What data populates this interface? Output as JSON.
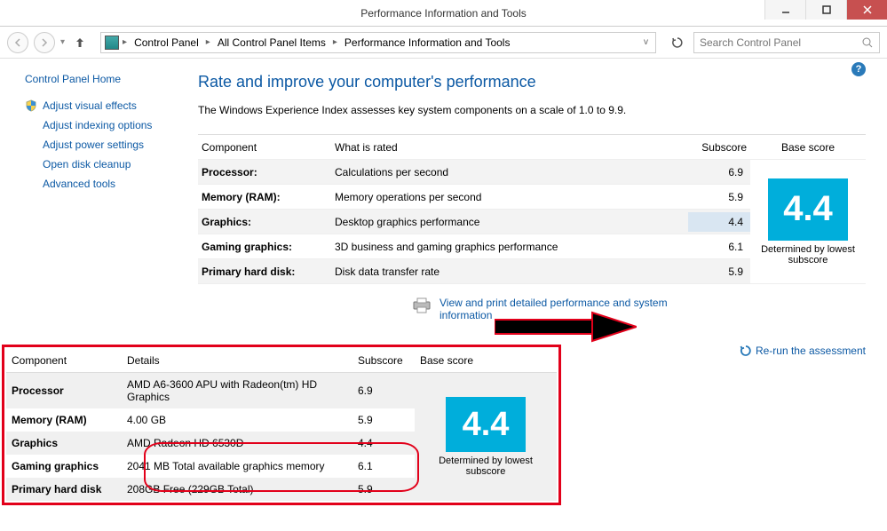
{
  "window": {
    "title": "Performance Information and Tools"
  },
  "breadcrumbs": {
    "a": "Control Panel",
    "b": "All Control Panel Items",
    "c": "Performance Information and Tools"
  },
  "search": {
    "placeholder": "Search Control Panel"
  },
  "sidebar": {
    "home": "Control Panel Home",
    "items": [
      "Adjust visual effects",
      "Adjust indexing options",
      "Adjust power settings",
      "Open disk cleanup",
      "Advanced tools"
    ]
  },
  "heading": "Rate and improve your computer's performance",
  "subtitle": "The Windows Experience Index assesses key system components on a scale of 1.0 to 9.9.",
  "table_headers": {
    "component": "Component",
    "what_rated": "What is rated",
    "subscore": "Subscore",
    "base_score": "Base score"
  },
  "rows": [
    {
      "label": "Processor:",
      "desc": "Calculations per second",
      "score": "6.9"
    },
    {
      "label": "Memory (RAM):",
      "desc": "Memory operations per second",
      "score": "5.9"
    },
    {
      "label": "Graphics:",
      "desc": "Desktop graphics performance",
      "score": "4.4"
    },
    {
      "label": "Gaming graphics:",
      "desc": "3D business and gaming graphics performance",
      "score": "6.1"
    },
    {
      "label": "Primary hard disk:",
      "desc": "Disk data transfer rate",
      "score": "5.9"
    }
  ],
  "base_score": "4.4",
  "determined_text": "Determined by lowest subscore",
  "link_view_print": "View and print detailed performance and system information",
  "link_rerun": "Re-run the assessment",
  "detail_headers": {
    "component": "Component",
    "details": "Details",
    "subscore": "Subscore",
    "base_score": "Base score"
  },
  "detail_rows": [
    {
      "label": "Processor",
      "detail": "AMD A6-3600 APU with Radeon(tm) HD Graphics",
      "score": "6.9"
    },
    {
      "label": "Memory (RAM)",
      "detail": "4.00 GB",
      "score": "5.9"
    },
    {
      "label": "Graphics",
      "detail": "AMD Radeon HD 6530D",
      "score": "4.4"
    },
    {
      "label": "Gaming graphics",
      "detail": "2041 MB Total available graphics memory",
      "score": "6.1"
    },
    {
      "label": "Primary hard disk",
      "detail": "208GB Free (229GB Total)",
      "score": "5.9"
    }
  ],
  "detail_base_score": "4.4",
  "detail_determined": "Determined by lowest subscore"
}
